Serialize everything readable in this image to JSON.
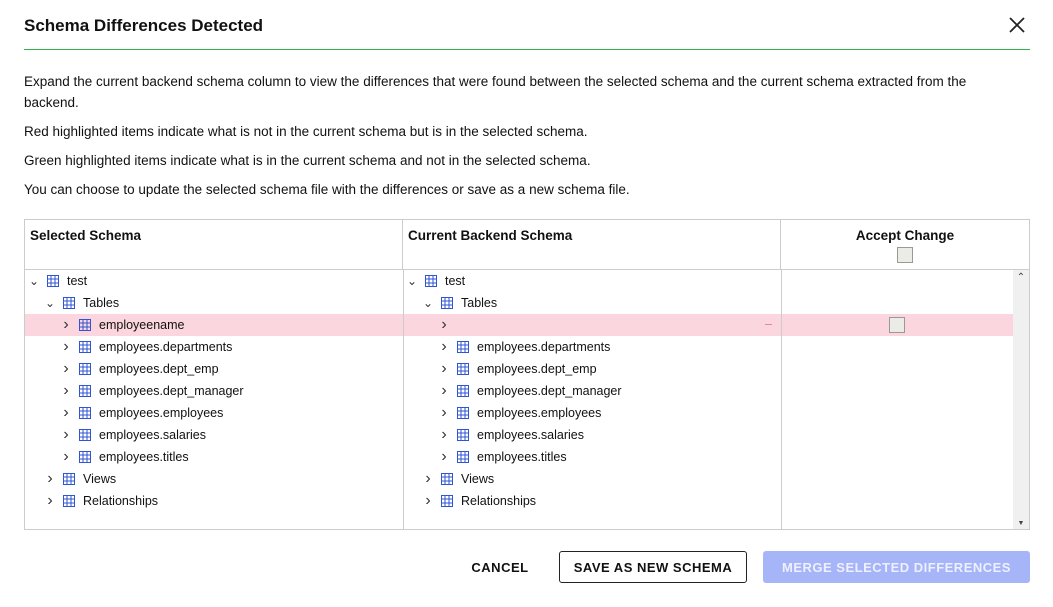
{
  "dialog": {
    "title": "Schema Differences Detected"
  },
  "description": [
    "Expand the current backend schema column to view the differences that were found between the selected schema and the current schema extracted from the backend.",
    "Red highlighted items indicate what is not in the current schema but is in the selected schema.",
    "Green highlighted items indicate what is in the current schema and not in the selected schema.",
    "You can choose to update the selected schema file with the differences or save as a new schema file."
  ],
  "table": {
    "headers": {
      "selected": "Selected Schema",
      "current": "Current Backend Schema",
      "accept": "Accept Change"
    },
    "rows": [
      {
        "level": 0,
        "expanded": true,
        "left": "test",
        "right": "test",
        "highlight": ""
      },
      {
        "level": 1,
        "expanded": true,
        "left": "Tables",
        "right": "Tables",
        "highlight": ""
      },
      {
        "level": 2,
        "expanded": false,
        "left": "employeename",
        "right": "",
        "highlight": "red",
        "checkbox": true
      },
      {
        "level": 2,
        "expanded": false,
        "left": "employees.departments",
        "right": "employees.departments",
        "highlight": ""
      },
      {
        "level": 2,
        "expanded": false,
        "left": "employees.dept_emp",
        "right": "employees.dept_emp",
        "highlight": ""
      },
      {
        "level": 2,
        "expanded": false,
        "left": "employees.dept_manager",
        "right": "employees.dept_manager",
        "highlight": ""
      },
      {
        "level": 2,
        "expanded": false,
        "left": "employees.employees",
        "right": "employees.employees",
        "highlight": ""
      },
      {
        "level": 2,
        "expanded": false,
        "left": "employees.salaries",
        "right": "employees.salaries",
        "highlight": ""
      },
      {
        "level": 2,
        "expanded": false,
        "left": "employees.titles",
        "right": "employees.titles",
        "highlight": ""
      },
      {
        "level": 1,
        "expanded": false,
        "left": "Views",
        "right": "Views",
        "highlight": ""
      },
      {
        "level": 1,
        "expanded": false,
        "left": "Relationships",
        "right": "Relationships",
        "highlight": ""
      }
    ]
  },
  "buttons": {
    "cancel": "CANCEL",
    "save_new": "SAVE AS NEW SCHEMA",
    "merge": "MERGE SELECTED DIFFERENCES"
  },
  "colors": {
    "accent_line": "#2fb24a",
    "red_highlight": "#fbd6de",
    "merge_disabled": "#a6b4f8",
    "icon_blue": "#2f55d4"
  }
}
